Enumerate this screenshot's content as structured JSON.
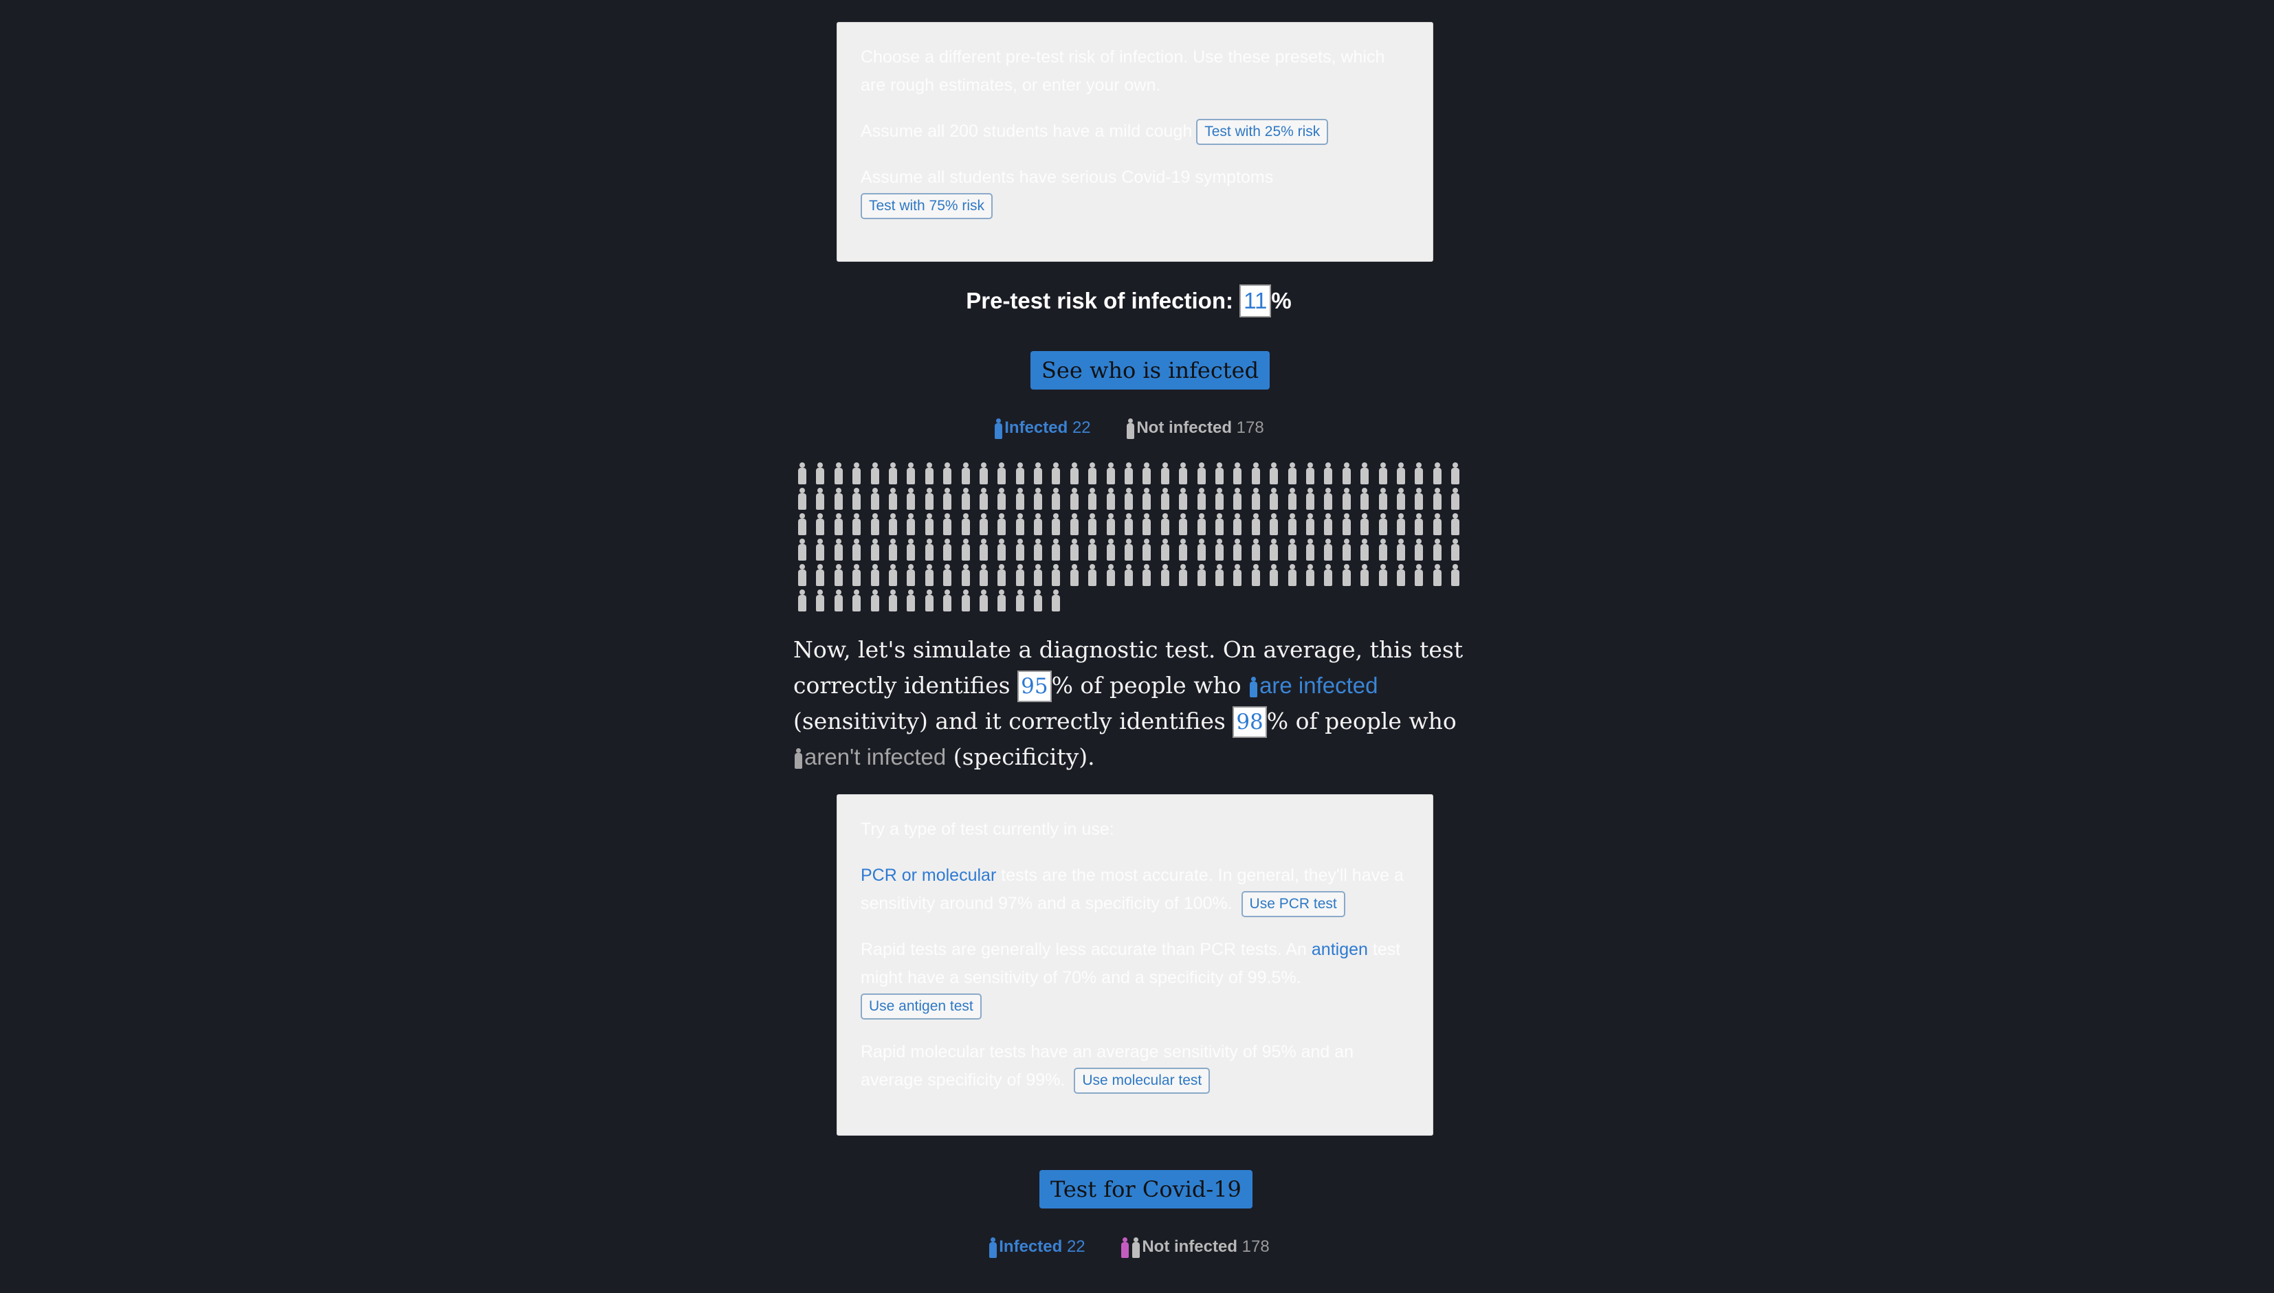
{
  "presets_panel": {
    "intro": "Choose a different pre-test risk of infection. Use these presets, which are rough estimates, or enter your own.",
    "mild_text": "Assume all 200 students have a mild cough",
    "mild_button": "Test with 25% risk",
    "serious_text": "Assume all students have serious Covid-19 symptoms",
    "serious_button": "Test with 75% risk"
  },
  "risk": {
    "label": "Pre-test risk of infection:",
    "value": "11",
    "unit": "%"
  },
  "see_button": "See who is infected",
  "legend1": {
    "infected_label": "Infected",
    "infected_count": "22",
    "not_infected_label": "Not infected",
    "not_infected_count": "178"
  },
  "grid": {
    "total": 200,
    "per_row": 37
  },
  "simulation": {
    "t1": "Now, let's simulate a diagnostic test. On average, this test correctly identifies ",
    "sensitivity": "95",
    "t2": "% of people who ",
    "infected_link": "are infected",
    "t3": " (sensitivity) and it correctly identifies ",
    "specificity": "98",
    "t4": "% of people who ",
    "noninfected_link": "aren't infected",
    "t5": " (specificity)."
  },
  "tests_panel": {
    "intro": "Try a type of test currently in use:",
    "pcr_link": "PCR or molecular",
    "pcr_text": " tests are the most accurate. In general, they'll have a sensitivity around 97% and a specificity of 100%.",
    "pcr_button": "Use PCR test",
    "rapid_text1": "Rapid tests are generally less accurate than PCR tests. An ",
    "antigen_link": "antigen",
    "rapid_text2": " test might have a sensitivity of 70% and a specificity of 99.5%.",
    "antigen_button": "Use antigen test",
    "molecular_text": "Rapid molecular tests have an average sensitivity of 95% and an average specificity of 99%.",
    "molecular_button": "Use molecular test"
  },
  "test_button": "Test for Covid-19",
  "legend2": {
    "infected_label": "Infected",
    "infected_count": "22",
    "not_infected_label": "Not infected",
    "not_infected_count": "178"
  },
  "colors": {
    "background": "#1b1d25",
    "accent": "#2f7fd0",
    "infected": "#3a82d3",
    "not_infected": "#b8b8b8",
    "false_positive": "#c45cc0"
  }
}
